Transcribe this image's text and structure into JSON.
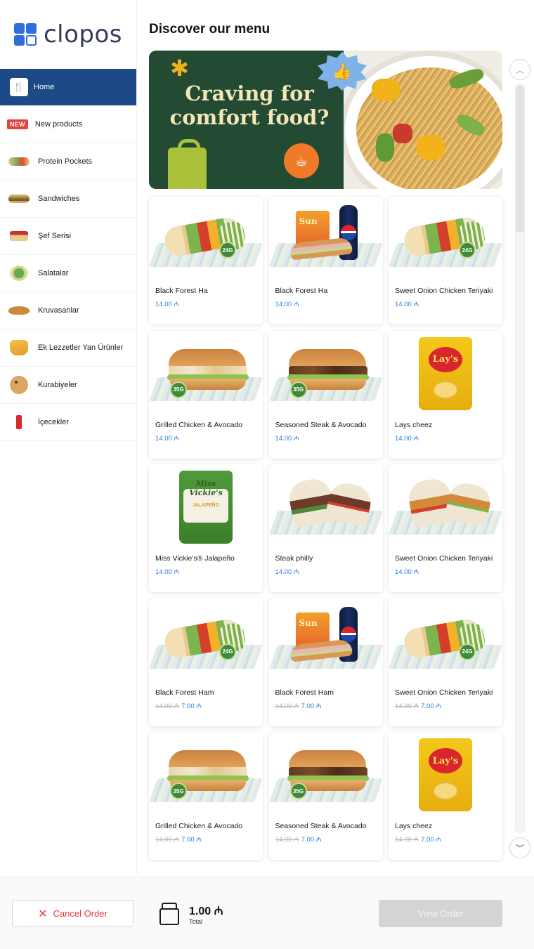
{
  "brand": {
    "name": "clopos",
    "accent": "#2e6fdb"
  },
  "sidebar": {
    "active_color": "#1d4a87",
    "items": [
      {
        "label": "Home",
        "icon": "utensils-icon",
        "active": true
      },
      {
        "label": "New products",
        "badge": "NEW"
      },
      {
        "label": "Protein Pockets"
      },
      {
        "label": "Sandwiches"
      },
      {
        "label": "Şef Serisi"
      },
      {
        "label": "Salatalar"
      },
      {
        "label": "Kruvasanlar"
      },
      {
        "label": "Ek Lezzetler Yan Ürünler"
      },
      {
        "label": "Kurabiyeler"
      },
      {
        "label": "İçecekler"
      }
    ]
  },
  "main": {
    "title": "Discover our menu",
    "banner": {
      "headline": "Craving for comfort food?"
    },
    "price_color": "#2a7de1",
    "products": [
      {
        "name": "Black Forest Ha",
        "price": "14.00 ₼",
        "art": "wrap"
      },
      {
        "name": "Black Forest Ha",
        "price": "14.00 ₼",
        "art": "combo"
      },
      {
        "name": "Sweet Onion Chicken Teriyaki",
        "price": "14.00 ₼",
        "art": "wrap"
      },
      {
        "name": "Grilled Chicken & Avocado",
        "price": "14.00 ₼",
        "art": "sub-chicken"
      },
      {
        "name": "Seasoned Steak & Avocado",
        "price": "14.00 ₼",
        "art": "sub-steak"
      },
      {
        "name": "Lays cheez",
        "price": "14.00 ₼",
        "art": "lays"
      },
      {
        "name": "Miss Vickie's® Jalapeño",
        "price": "14.00 ₼",
        "art": "vickie"
      },
      {
        "name": "Steak philly",
        "price": "14.00 ₼",
        "art": "burrito-steak"
      },
      {
        "name": "Sweet Onion Chicken Teriyaki",
        "price": "14.00 ₼",
        "art": "burrito-chicken"
      },
      {
        "name": "Black Forest Ham",
        "old_price": "14.00 ₼",
        "price": "7.00 ₼",
        "art": "wrap"
      },
      {
        "name": "Black Forest Ham",
        "old_price": "14.00 ₼",
        "price": "7.00 ₼",
        "art": "combo"
      },
      {
        "name": "Sweet Onion Chicken Teriyaki",
        "old_price": "14.00 ₼",
        "price": "7.00 ₼",
        "art": "wrap"
      },
      {
        "name": "Grilled Chicken & Avocado",
        "old_price": "14.00 ₼",
        "price": "7.00 ₼",
        "art": "sub-chicken"
      },
      {
        "name": "Seasoned Steak & Avocado",
        "old_price": "14.00 ₼",
        "price": "7.00 ₼",
        "art": "sub-steak"
      },
      {
        "name": "Lays cheez",
        "old_price": "14.00 ₼",
        "price": "7.00 ₼",
        "art": "lays"
      }
    ]
  },
  "footer": {
    "cancel_label": "Cancel Order",
    "total_value": "1.00 ₼",
    "total_label": "Total",
    "view_label": "View Order"
  }
}
